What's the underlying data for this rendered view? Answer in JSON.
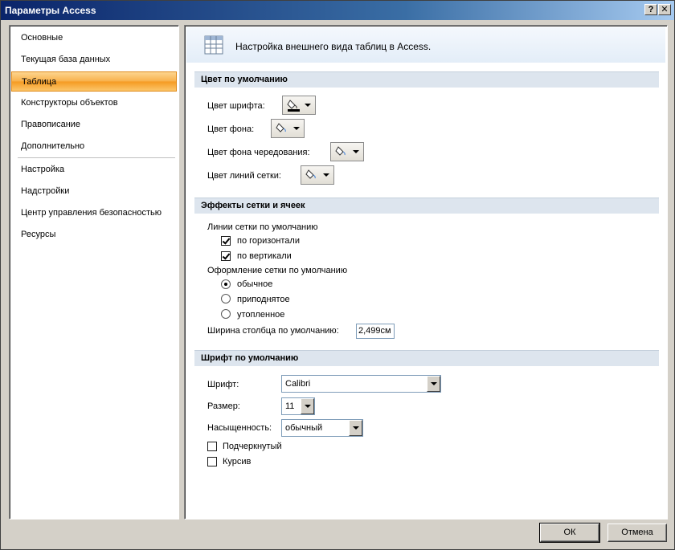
{
  "window": {
    "title": "Параметры Access",
    "help_glyph": "?",
    "close_glyph": "✕"
  },
  "nav": {
    "items": [
      {
        "label": "Основные",
        "active": false
      },
      {
        "label": "Текущая база данных",
        "active": false
      },
      {
        "label": "Таблица",
        "active": true
      },
      {
        "label": "Конструкторы объектов",
        "active": false
      },
      {
        "label": "Правописание",
        "active": false
      },
      {
        "label": "Дополнительно",
        "active": false
      },
      {
        "label": "Настройка",
        "active": false
      },
      {
        "label": "Надстройки",
        "active": false
      },
      {
        "label": "Центр управления безопасностью",
        "active": false
      },
      {
        "label": "Ресурсы",
        "active": false
      }
    ],
    "active_color": "#f8b04a"
  },
  "header": {
    "text": "Настройка внешнего вида таблиц в Access."
  },
  "sections": {
    "colors": "Цвет по умолчанию",
    "effects": "Эффекты сетки и ячеек",
    "font": "Шрифт по умолчанию"
  },
  "colors": {
    "font_color_label": "Цвет шрифта:",
    "background_label": "Цвет фона:",
    "alt_background_label": "Цвет фона чередования:",
    "gridline_label": "Цвет линий сетки:",
    "font_color_value": "#000000"
  },
  "effects": {
    "gridlines_label": "Линии сетки по умолчанию",
    "horizontal_label": "по горизонтали",
    "horizontal_checked": true,
    "vertical_label": "по вертикали",
    "vertical_checked": true,
    "cell_effect_label": "Оформление сетки по умолчанию",
    "flat_label": "обычное",
    "raised_label": "приподнятое",
    "sunken_label": "утопленное",
    "selected_effect": "flat",
    "column_width_label": "Ширина столбца по умолчанию:",
    "column_width_value": "2,499см"
  },
  "font": {
    "font_label": "Шрифт:",
    "font_value": "Calibri",
    "size_label": "Размер:",
    "size_value": "11",
    "weight_label": "Насыщенность:",
    "weight_value": "обычный",
    "underline_label": "Подчеркнутый",
    "underline_checked": false,
    "italic_label": "Курсив",
    "italic_checked": false
  },
  "buttons": {
    "ok": "ОК",
    "cancel": "Отмена"
  }
}
